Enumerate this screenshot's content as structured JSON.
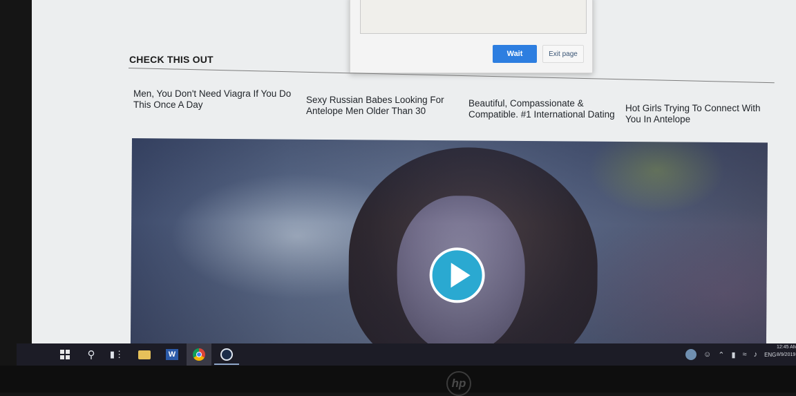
{
  "dialog": {
    "wait_button": "Wait",
    "exit_button": "Exit page"
  },
  "section": {
    "title": "CHECK THIS OUT"
  },
  "links": [
    {
      "text": "Men, You Don't Need Viagra If You Do This Once A Day"
    },
    {
      "text": "Sexy Russian Babes Looking For Antelope Men Older Than 30"
    },
    {
      "text": "Beautiful, Compassionate & Compatible. #1 International Dating"
    },
    {
      "text": "Hot Girls Trying To Connect With You In Antelope"
    }
  ],
  "video": {
    "play_icon": "play-icon",
    "accent_color": "#2aa9d1"
  },
  "taskbar": {
    "icons": [
      "windows-start-icon",
      "search-icon",
      "task-view-icon",
      "file-explorer-icon",
      "word-icon",
      "chrome-icon",
      "steam-icon"
    ],
    "tray": {
      "language": "ENG",
      "time": "12:45 AM",
      "date": "8/9/2019"
    }
  },
  "bezel": {
    "logo_text": "hp"
  }
}
